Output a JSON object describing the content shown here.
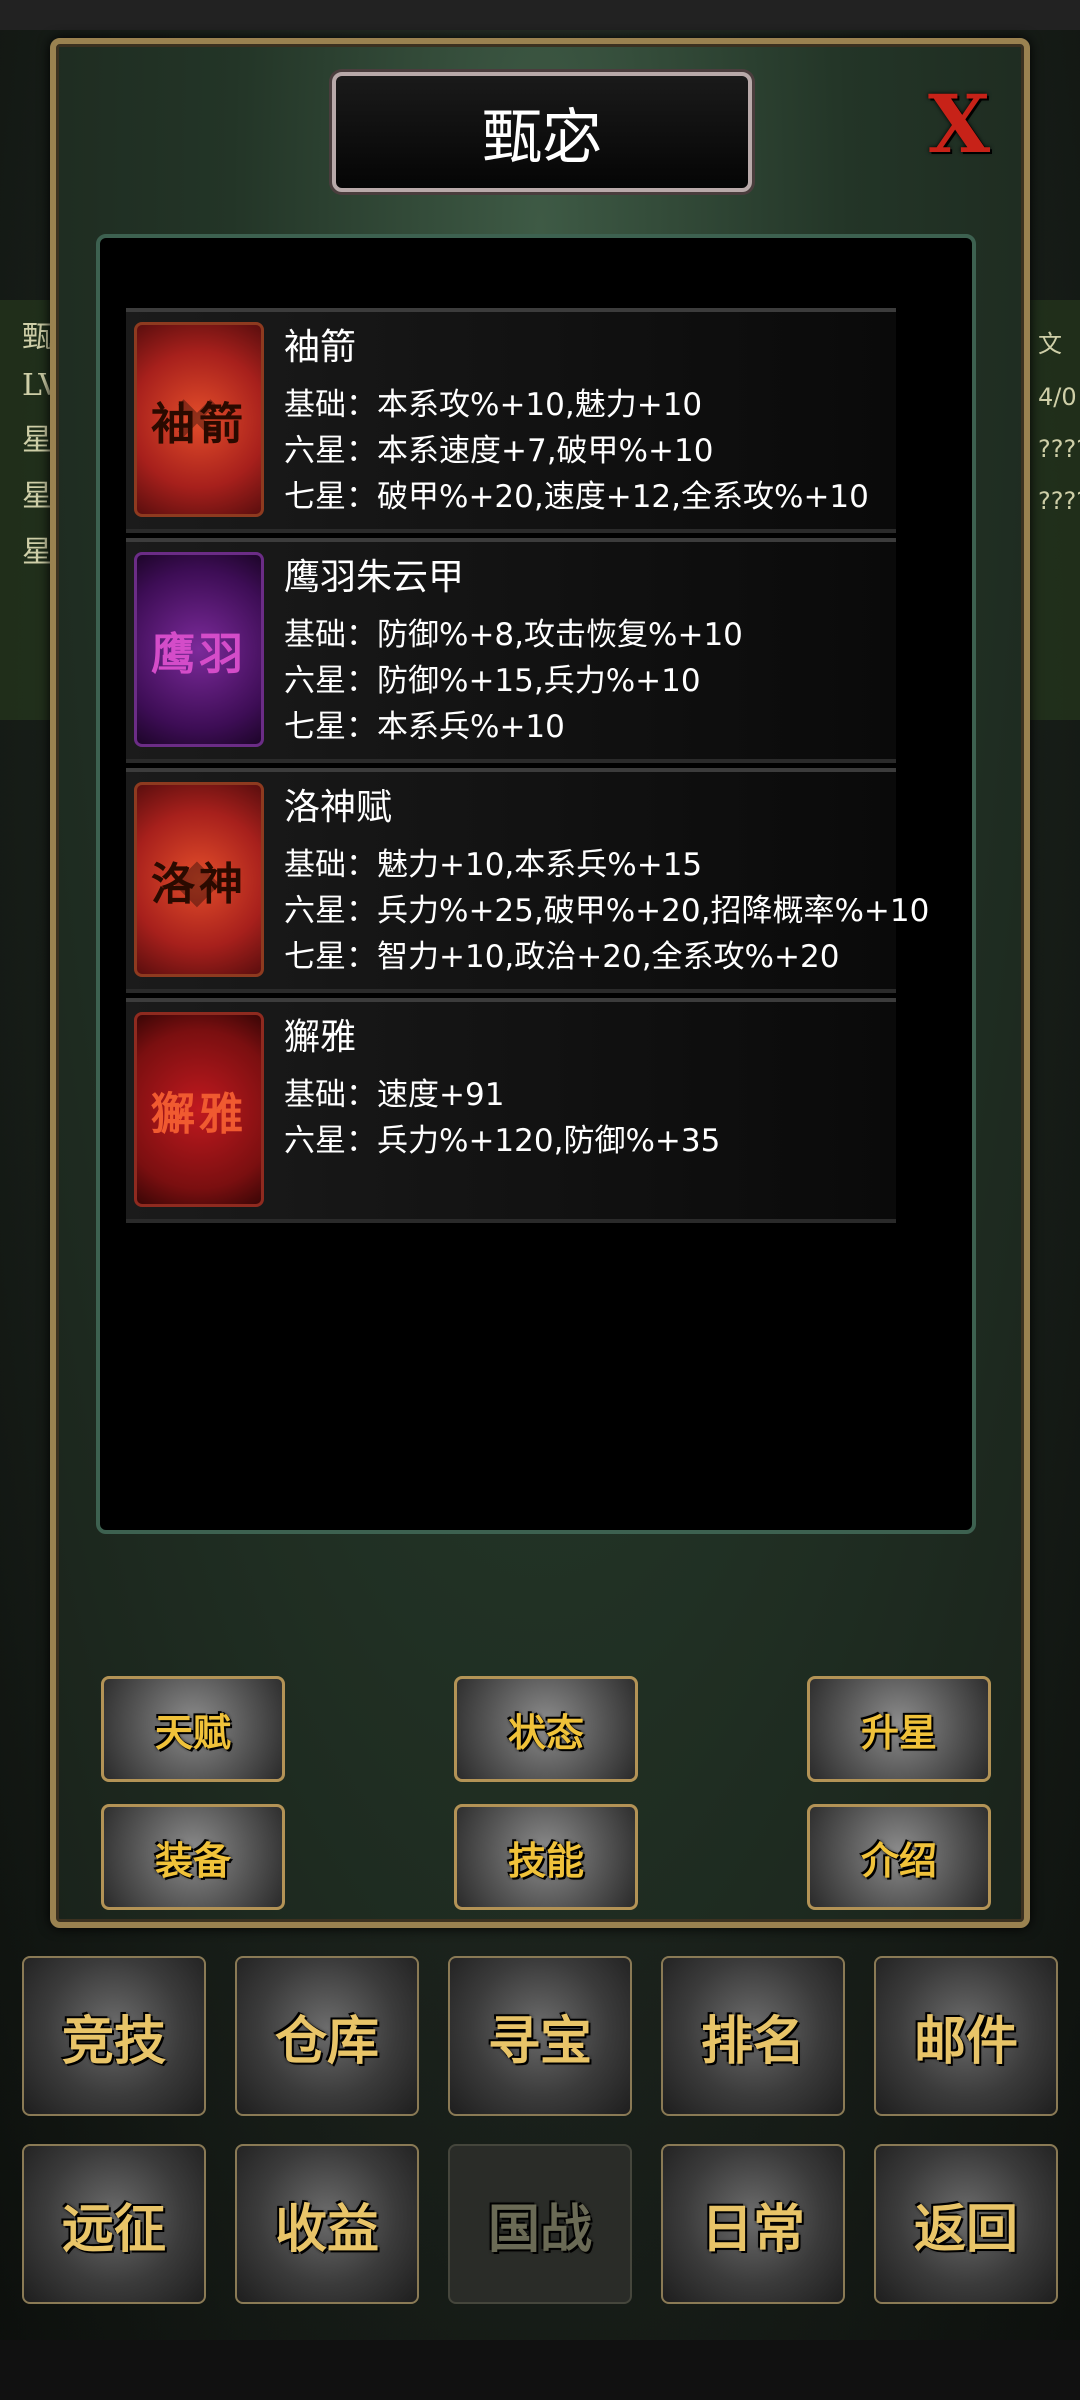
{
  "dialog": {
    "title": "甄宓",
    "close_label": "X"
  },
  "background": {
    "left_chars": [
      "甄",
      "LV",
      "星",
      "星",
      "星"
    ],
    "right_chars": [
      "文",
      "4/0",
      "????",
      "????"
    ]
  },
  "items": [
    {
      "name": "袖箭",
      "icon_text": "袖箭",
      "icon_name": "sleeve-arrow-icon",
      "lines": [
        "基础：本系攻%+10,魅力+10",
        "六星：本系速度+7,破甲%+10",
        "七星：破甲%+20,速度+12,全系攻%+10"
      ]
    },
    {
      "name": "鹰羽朱云甲",
      "icon_text": "鹰羽",
      "icon_name": "eagle-feather-armor-icon",
      "lines": [
        "基础：防御%+8,攻击恢复%+10",
        "六星：防御%+15,兵力%+10",
        "七星：本系兵%+10"
      ]
    },
    {
      "name": "洛神赋",
      "icon_text": "洛神",
      "icon_name": "luoshen-scroll-icon",
      "lines": [
        "基础：魅力+10,本系兵%+15",
        "六星：兵力%+25,破甲%+20,招降概率%+10",
        "七星：智力+10,政治+20,全系攻%+20"
      ]
    },
    {
      "name": "獬雅",
      "icon_text": "獬雅",
      "icon_name": "horse-mount-icon",
      "lines": [
        "基础：速度+91",
        "六星：兵力%+120,防御%+35"
      ]
    }
  ],
  "buttons": {
    "talent": "天赋",
    "status": "状态",
    "star_up": "升星",
    "equipment": "装备",
    "skill": "技能",
    "intro": "介绍"
  },
  "nav": {
    "row1": [
      "竞技",
      "仓库",
      "寻宝",
      "排名",
      "邮件"
    ],
    "row2": [
      "远征",
      "收益",
      "国战",
      "日常",
      "返回"
    ]
  },
  "colors": {
    "gold_text": "#f0c23a",
    "close_red": "#c72218",
    "frame_gold": "#9a8250"
  }
}
